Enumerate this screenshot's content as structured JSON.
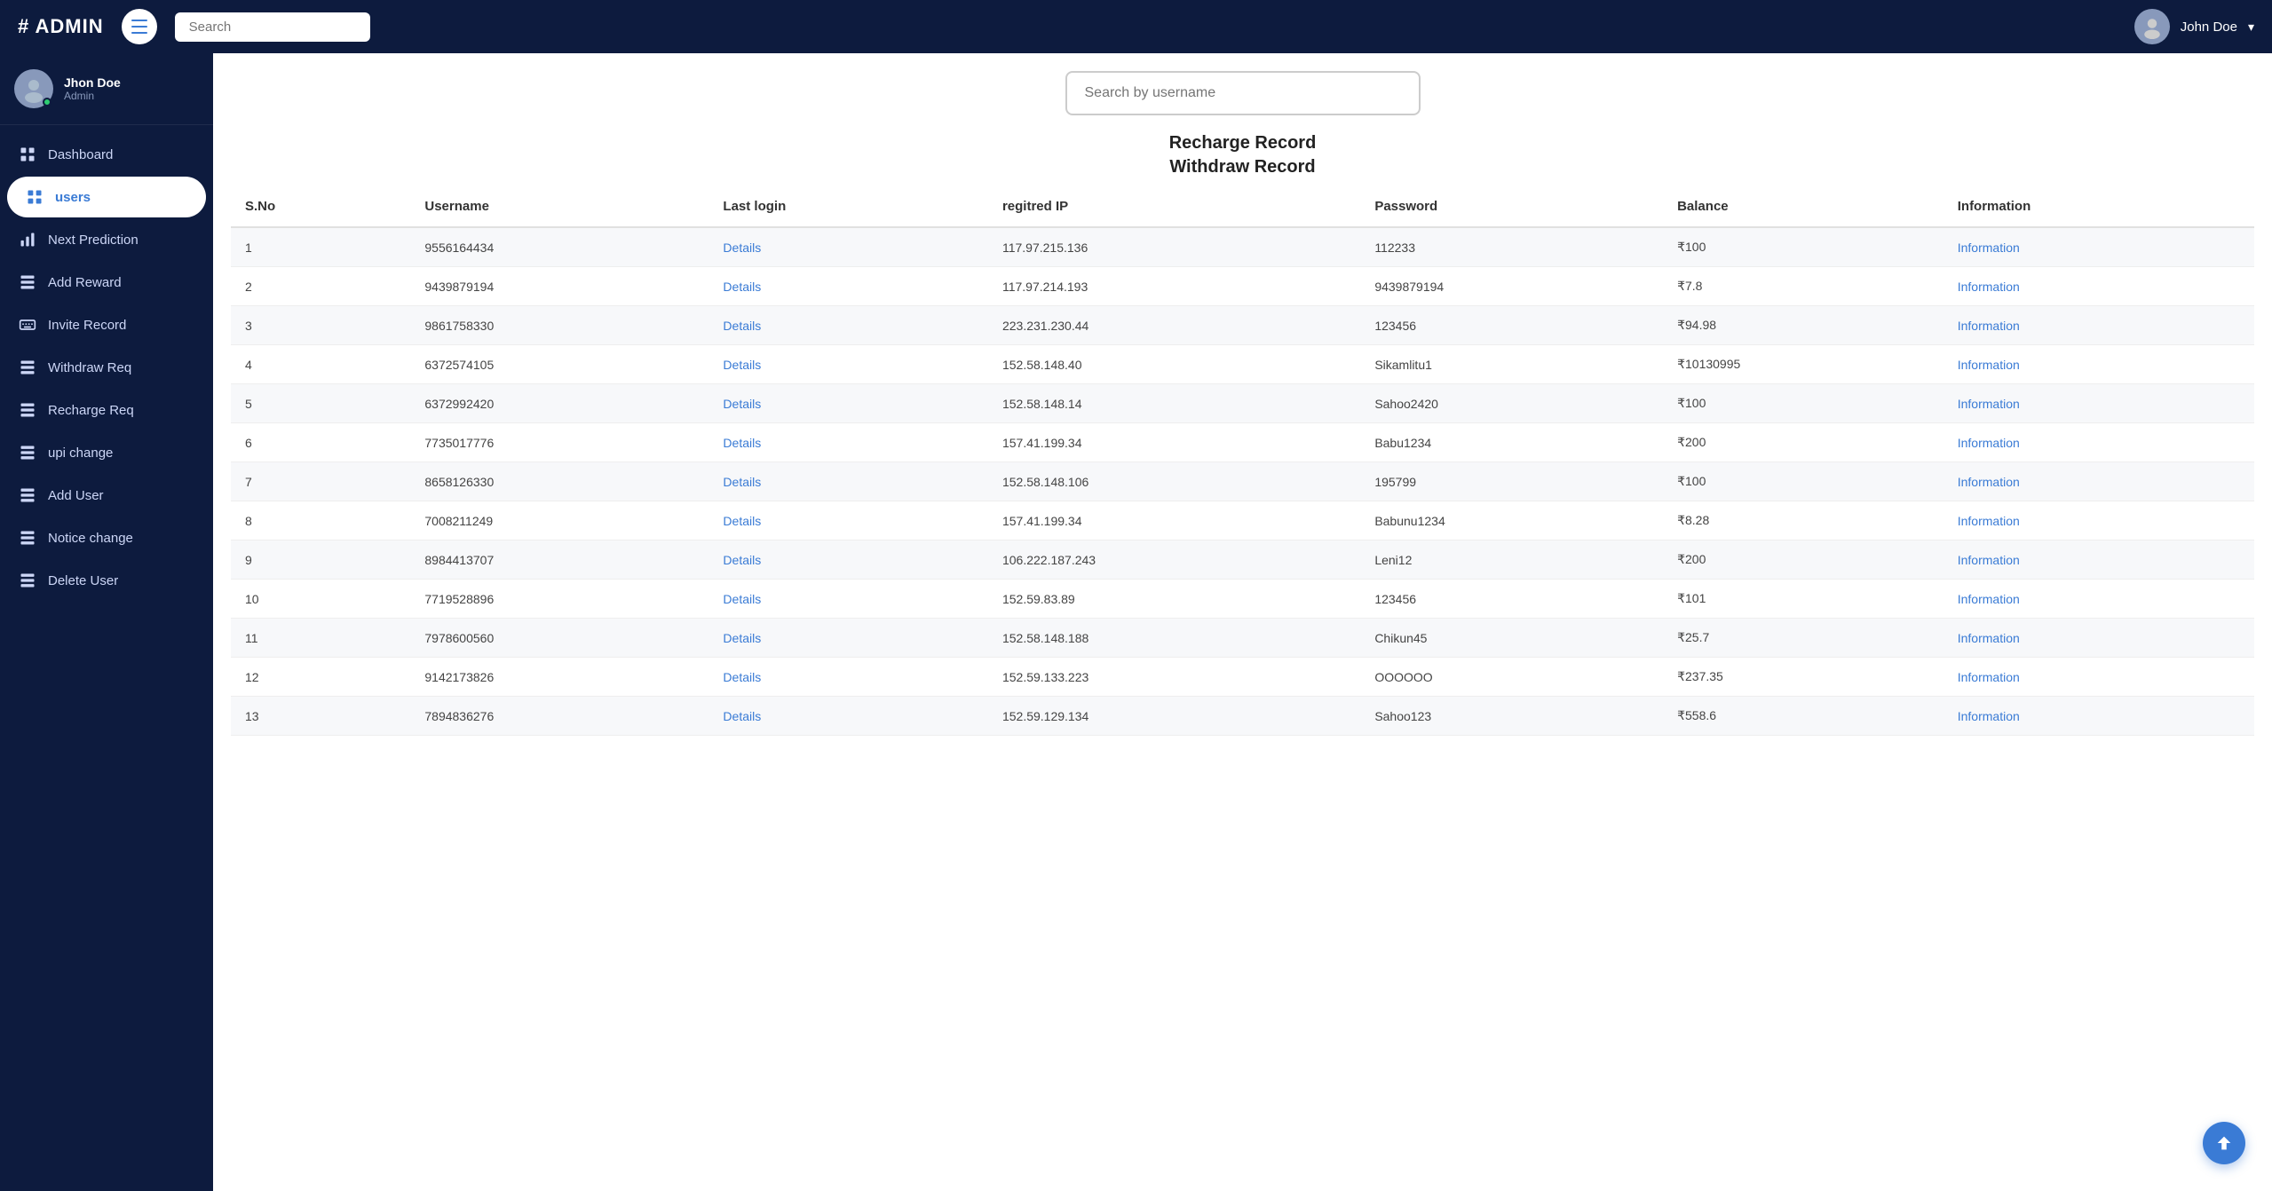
{
  "navbar": {
    "brand": "# ADMIN",
    "search_placeholder": "Search",
    "username": "John Doe",
    "dropdown_arrow": "▾"
  },
  "sidebar": {
    "user": {
      "name": "Jhon Doe",
      "role": "Admin"
    },
    "items": [
      {
        "id": "dashboard",
        "label": "Dashboard",
        "icon": "dashboard-icon"
      },
      {
        "id": "users",
        "label": "users",
        "icon": "grid-icon",
        "active": true
      },
      {
        "id": "next-prediction",
        "label": "Next Prediction",
        "icon": "chart-icon"
      },
      {
        "id": "add-reward",
        "label": "Add Reward",
        "icon": "table-icon"
      },
      {
        "id": "invite-record",
        "label": "Invite Record",
        "icon": "keyboard-icon"
      },
      {
        "id": "withdraw-req",
        "label": "Withdraw Req",
        "icon": "table2-icon"
      },
      {
        "id": "recharge-req",
        "label": "Recharge Req",
        "icon": "table3-icon"
      },
      {
        "id": "upi-change",
        "label": "upi change",
        "icon": "table4-icon"
      },
      {
        "id": "add-user",
        "label": "Add User",
        "icon": "table5-icon"
      },
      {
        "id": "notice-change",
        "label": "Notice change",
        "icon": "table6-icon"
      },
      {
        "id": "delete-user",
        "label": "Delete User",
        "icon": "table7-icon"
      }
    ]
  },
  "main": {
    "search_placeholder": "Search by username",
    "headings": [
      "Recharge Record",
      "Withdraw Record"
    ],
    "table": {
      "columns": [
        "S.No",
        "Username",
        "Last login",
        "regitred IP",
        "Password",
        "Balance",
        "Information"
      ],
      "rows": [
        {
          "sno": "1",
          "username": "9556164434",
          "last_login": "Details",
          "ip": "117.97.215.136",
          "password": "112233",
          "balance": "₹100",
          "info": "Information"
        },
        {
          "sno": "2",
          "username": "9439879194",
          "last_login": "Details",
          "ip": "117.97.214.193",
          "password": "9439879194",
          "balance": "₹7.8",
          "info": "Information"
        },
        {
          "sno": "3",
          "username": "9861758330",
          "last_login": "Details",
          "ip": "223.231.230.44",
          "password": "123456",
          "balance": "₹94.98",
          "info": "Information"
        },
        {
          "sno": "4",
          "username": "6372574105",
          "last_login": "Details",
          "ip": "152.58.148.40",
          "password": "Sikamlitu1",
          "balance": "₹10130995",
          "info": "Information"
        },
        {
          "sno": "5",
          "username": "6372992420",
          "last_login": "Details",
          "ip": "152.58.148.14",
          "password": "Sahoo2420",
          "balance": "₹100",
          "info": "Information"
        },
        {
          "sno": "6",
          "username": "7735017776",
          "last_login": "Details",
          "ip": "157.41.199.34",
          "password": "Babu1234",
          "balance": "₹200",
          "info": "Information"
        },
        {
          "sno": "7",
          "username": "8658126330",
          "last_login": "Details",
          "ip": "152.58.148.106",
          "password": "195799",
          "balance": "₹100",
          "info": "Information"
        },
        {
          "sno": "8",
          "username": "7008211249",
          "last_login": "Details",
          "ip": "157.41.199.34",
          "password": "Babunu1234",
          "balance": "₹8.28",
          "info": "Information"
        },
        {
          "sno": "9",
          "username": "8984413707",
          "last_login": "Details",
          "ip": "106.222.187.243",
          "password": "Leni12",
          "balance": "₹200",
          "info": "Information"
        },
        {
          "sno": "10",
          "username": "7719528896",
          "last_login": "Details",
          "ip": "152.59.83.89",
          "password": "123456",
          "balance": "₹101",
          "info": "Information"
        },
        {
          "sno": "11",
          "username": "7978600560",
          "last_login": "Details",
          "ip": "152.58.148.188",
          "password": "Chikun45",
          "balance": "₹25.7",
          "info": "Information"
        },
        {
          "sno": "12",
          "username": "9142173826",
          "last_login": "Details",
          "ip": "152.59.133.223",
          "password": "OOOOOO",
          "balance": "₹237.35",
          "info": "Information"
        },
        {
          "sno": "13",
          "username": "7894836276",
          "last_login": "Details",
          "ip": "152.59.129.134",
          "password": "Sahoo123",
          "balance": "₹558.6",
          "info": "Information"
        }
      ]
    }
  }
}
